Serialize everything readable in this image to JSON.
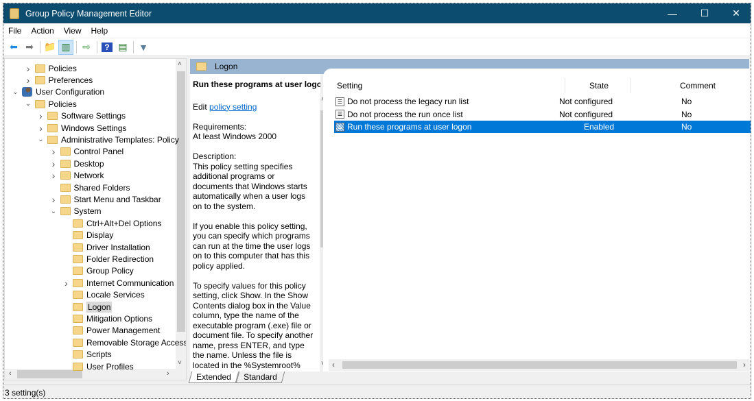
{
  "window": {
    "title": "Group Policy Management Editor",
    "minimize": "—",
    "maximize": "☐",
    "close": "✕"
  },
  "menu": [
    "File",
    "Action",
    "View",
    "Help"
  ],
  "toolbar": [
    {
      "icon": "back-arrow-icon",
      "glyph": "⬅",
      "color": "#1e88e5"
    },
    {
      "icon": "forward-arrow-icon",
      "glyph": "➡",
      "color": "#777777"
    },
    {
      "icon": "up-folder-icon",
      "glyph": "📁",
      "color": "#c9a227"
    },
    {
      "icon": "show-hide-console-tree-icon",
      "glyph": "▥",
      "color": "#2e7d32",
      "active": true
    },
    {
      "icon": "export-list-icon",
      "glyph": "⇨",
      "color": "#43a047"
    },
    {
      "icon": "help-icon",
      "glyph": "?",
      "color": "#ffffff"
    },
    {
      "icon": "show-action-pane-icon",
      "glyph": "▤",
      "color": "#2e7d32"
    },
    {
      "icon": "filter-icon",
      "glyph": "▼",
      "color": "#5b7c99"
    }
  ],
  "tree": [
    {
      "label": "Policies",
      "level": 1,
      "expander": "collapsed",
      "icon": "folder"
    },
    {
      "label": "Preferences",
      "level": 1,
      "expander": "collapsed",
      "icon": "folder"
    },
    {
      "label": "User Configuration",
      "level": 0,
      "expander": "expanded",
      "icon": "user"
    },
    {
      "label": "Policies",
      "level": 1,
      "expander": "expanded",
      "icon": "folder"
    },
    {
      "label": "Software Settings",
      "level": 2,
      "expander": "collapsed",
      "icon": "folder"
    },
    {
      "label": "Windows Settings",
      "level": 2,
      "expander": "collapsed",
      "icon": "folder"
    },
    {
      "label": "Administrative Templates: Policy",
      "level": 2,
      "expander": "expanded",
      "icon": "folder"
    },
    {
      "label": "Control Panel",
      "level": 3,
      "expander": "collapsed",
      "icon": "folder"
    },
    {
      "label": "Desktop",
      "level": 3,
      "expander": "collapsed",
      "icon": "folder"
    },
    {
      "label": "Network",
      "level": 3,
      "expander": "collapsed",
      "icon": "folder"
    },
    {
      "label": "Shared Folders",
      "level": 3,
      "expander": "none",
      "icon": "folder"
    },
    {
      "label": "Start Menu and Taskbar",
      "level": 3,
      "expander": "collapsed",
      "icon": "folder"
    },
    {
      "label": "System",
      "level": 3,
      "expander": "expanded",
      "icon": "folder"
    },
    {
      "label": "Ctrl+Alt+Del Options",
      "level": 4,
      "expander": "none",
      "icon": "folder"
    },
    {
      "label": "Display",
      "level": 4,
      "expander": "none",
      "icon": "folder"
    },
    {
      "label": "Driver Installation",
      "level": 4,
      "expander": "none",
      "icon": "folder"
    },
    {
      "label": "Folder Redirection",
      "level": 4,
      "expander": "none",
      "icon": "folder"
    },
    {
      "label": "Group Policy",
      "level": 4,
      "expander": "none",
      "icon": "folder"
    },
    {
      "label": "Internet Communication",
      "level": 4,
      "expander": "collapsed",
      "icon": "folder"
    },
    {
      "label": "Locale Services",
      "level": 4,
      "expander": "none",
      "icon": "folder"
    },
    {
      "label": "Logon",
      "level": 4,
      "expander": "none",
      "icon": "folder",
      "selected": true
    },
    {
      "label": "Mitigation Options",
      "level": 4,
      "expander": "none",
      "icon": "folder"
    },
    {
      "label": "Power Management",
      "level": 4,
      "expander": "none",
      "icon": "folder"
    },
    {
      "label": "Removable Storage Access",
      "level": 4,
      "expander": "none",
      "icon": "folder"
    },
    {
      "label": "Scripts",
      "level": 4,
      "expander": "none",
      "icon": "folder"
    },
    {
      "label": "User Profiles",
      "level": 4,
      "expander": "none",
      "icon": "folder"
    }
  ],
  "header": {
    "title": "Logon"
  },
  "description": {
    "title": "Run these programs at user logon",
    "edit_prefix": "Edit ",
    "edit_link": "policy setting",
    "requirements_label": "Requirements:",
    "requirements": "At least Windows 2000",
    "description_label": "Description:",
    "paragraphs": [
      "This policy setting specifies additional programs or documents that Windows starts automatically when a user logs on to the system.",
      "If you enable this policy setting, you can specify which programs can run at the time the user logs on to this computer that has this policy applied.",
      "To specify values for this policy setting, click Show. In the Show Contents dialog box in the Value column, type the name of the executable program (.exe) file or document file. To specify another name, press ENTER, and type the name. Unless the file is located in the %Systemroot% directory, you"
    ]
  },
  "list": {
    "columns": [
      "Setting",
      "State",
      "Comment"
    ],
    "rows": [
      {
        "setting": "Do not process the legacy run list",
        "state": "Not configured",
        "comment": "No"
      },
      {
        "setting": "Do not process the run once list",
        "state": "Not configured",
        "comment": "No"
      },
      {
        "setting": "Run these programs at user logon",
        "state": "Enabled",
        "comment": "No",
        "selected": true
      }
    ]
  },
  "tabs": [
    {
      "label": "Extended",
      "active": true
    },
    {
      "label": "Standard",
      "active": false
    }
  ],
  "status": "3 setting(s)",
  "colors": {
    "titlebar": "#0c4c6e",
    "selection": "#0078d7",
    "header_band": "#99b4d1",
    "link": "#0066cc"
  }
}
